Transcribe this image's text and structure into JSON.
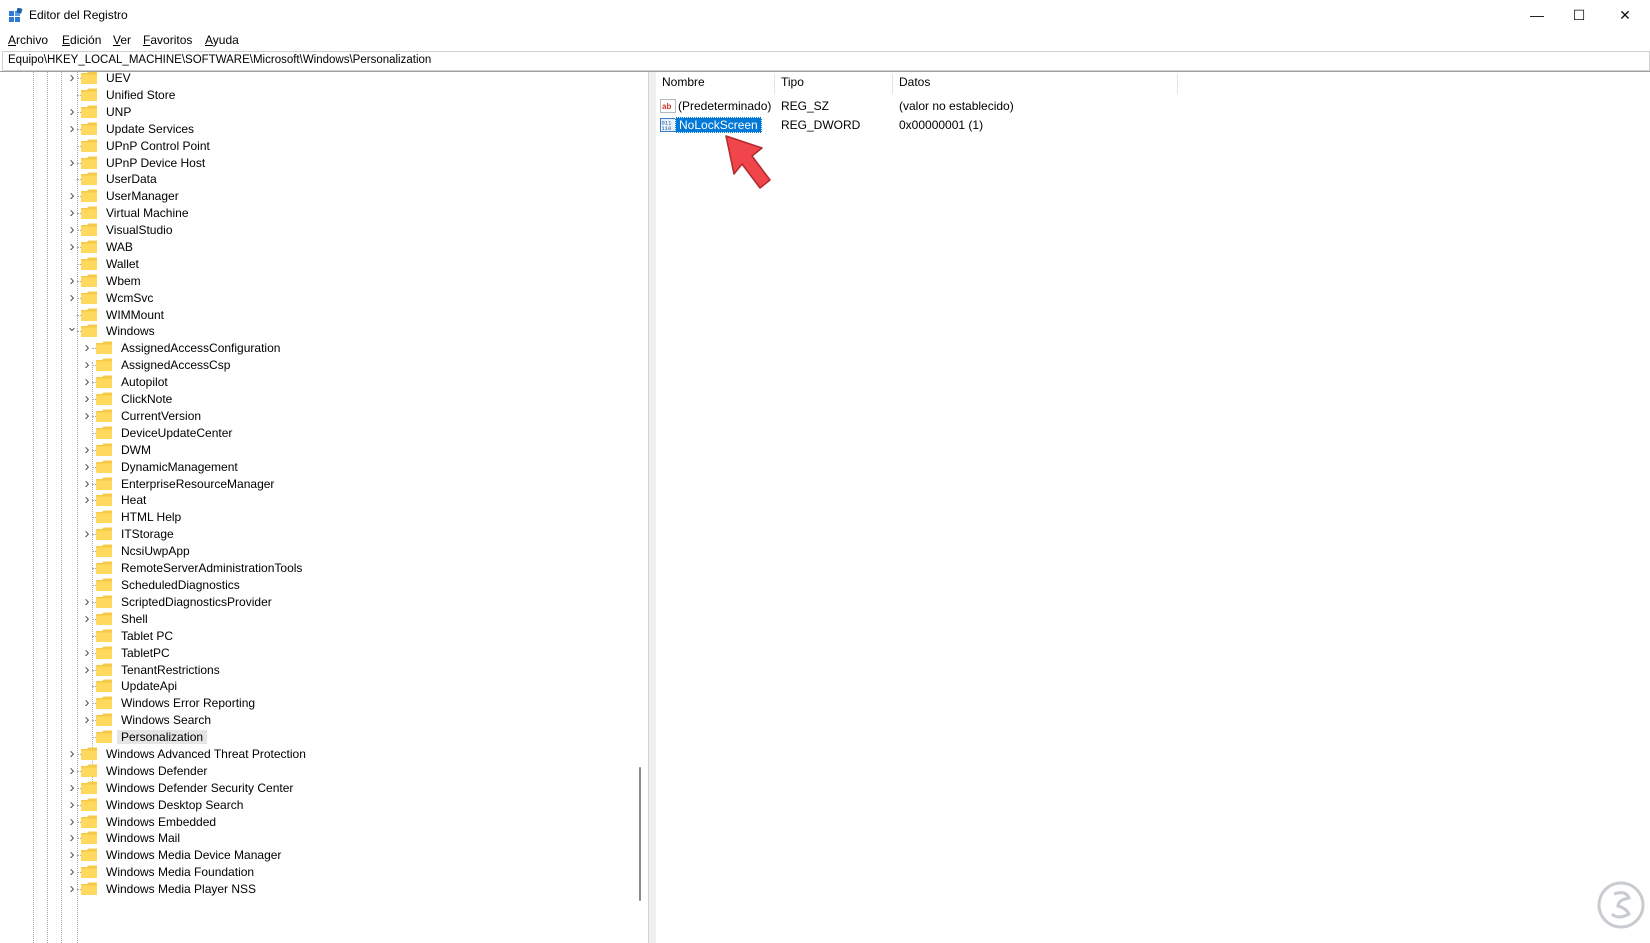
{
  "window": {
    "title": "Editor del Registro",
    "controls": {
      "minimize": "—",
      "maximize": "☐",
      "close": "✕"
    }
  },
  "menu": [
    "Archivo",
    "Edición",
    "Ver",
    "Favoritos",
    "Ayuda"
  ],
  "address": "Equipo\\HKEY_LOCAL_MACHINE\\SOFTWARE\\Microsoft\\Windows\\Personalization",
  "tree": {
    "selected": "Personalization",
    "nodes": [
      {
        "label": "UEV",
        "level": 1,
        "expand": "collapsed"
      },
      {
        "label": "Unified Store",
        "level": 1,
        "expand": "none"
      },
      {
        "label": "UNP",
        "level": 1,
        "expand": "collapsed"
      },
      {
        "label": "Update Services",
        "level": 1,
        "expand": "collapsed"
      },
      {
        "label": "UPnP Control Point",
        "level": 1,
        "expand": "none"
      },
      {
        "label": "UPnP Device Host",
        "level": 1,
        "expand": "collapsed"
      },
      {
        "label": "UserData",
        "level": 1,
        "expand": "none"
      },
      {
        "label": "UserManager",
        "level": 1,
        "expand": "collapsed"
      },
      {
        "label": "Virtual Machine",
        "level": 1,
        "expand": "collapsed"
      },
      {
        "label": "VisualStudio",
        "level": 1,
        "expand": "collapsed"
      },
      {
        "label": "WAB",
        "level": 1,
        "expand": "collapsed"
      },
      {
        "label": "Wallet",
        "level": 1,
        "expand": "none"
      },
      {
        "label": "Wbem",
        "level": 1,
        "expand": "collapsed"
      },
      {
        "label": "WcmSvc",
        "level": 1,
        "expand": "collapsed"
      },
      {
        "label": "WIMMount",
        "level": 1,
        "expand": "none"
      },
      {
        "label": "Windows",
        "level": 1,
        "expand": "expanded"
      },
      {
        "label": "AssignedAccessConfiguration",
        "level": 2,
        "expand": "collapsed"
      },
      {
        "label": "AssignedAccessCsp",
        "level": 2,
        "expand": "collapsed"
      },
      {
        "label": "Autopilot",
        "level": 2,
        "expand": "collapsed"
      },
      {
        "label": "ClickNote",
        "level": 2,
        "expand": "collapsed"
      },
      {
        "label": "CurrentVersion",
        "level": 2,
        "expand": "collapsed"
      },
      {
        "label": "DeviceUpdateCenter",
        "level": 2,
        "expand": "none"
      },
      {
        "label": "DWM",
        "level": 2,
        "expand": "collapsed"
      },
      {
        "label": "DynamicManagement",
        "level": 2,
        "expand": "collapsed"
      },
      {
        "label": "EnterpriseResourceManager",
        "level": 2,
        "expand": "collapsed"
      },
      {
        "label": "Heat",
        "level": 2,
        "expand": "collapsed"
      },
      {
        "label": "HTML Help",
        "level": 2,
        "expand": "none"
      },
      {
        "label": "ITStorage",
        "level": 2,
        "expand": "collapsed"
      },
      {
        "label": "NcsiUwpApp",
        "level": 2,
        "expand": "none"
      },
      {
        "label": "RemoteServerAdministrationTools",
        "level": 2,
        "expand": "none"
      },
      {
        "label": "ScheduledDiagnostics",
        "level": 2,
        "expand": "none"
      },
      {
        "label": "ScriptedDiagnosticsProvider",
        "level": 2,
        "expand": "collapsed"
      },
      {
        "label": "Shell",
        "level": 2,
        "expand": "collapsed"
      },
      {
        "label": "Tablet PC",
        "level": 2,
        "expand": "none"
      },
      {
        "label": "TabletPC",
        "level": 2,
        "expand": "collapsed"
      },
      {
        "label": "TenantRestrictions",
        "level": 2,
        "expand": "collapsed"
      },
      {
        "label": "UpdateApi",
        "level": 2,
        "expand": "none"
      },
      {
        "label": "Windows Error Reporting",
        "level": 2,
        "expand": "collapsed"
      },
      {
        "label": "Windows Search",
        "level": 2,
        "expand": "collapsed"
      },
      {
        "label": "Personalization",
        "level": 2,
        "expand": "none"
      },
      {
        "label": "Windows Advanced Threat Protection",
        "level": 1,
        "expand": "collapsed"
      },
      {
        "label": "Windows Defender",
        "level": 1,
        "expand": "collapsed"
      },
      {
        "label": "Windows Defender Security Center",
        "level": 1,
        "expand": "collapsed"
      },
      {
        "label": "Windows Desktop Search",
        "level": 1,
        "expand": "collapsed"
      },
      {
        "label": "Windows Embedded",
        "level": 1,
        "expand": "collapsed"
      },
      {
        "label": "Windows Mail",
        "level": 1,
        "expand": "collapsed"
      },
      {
        "label": "Windows Media Device Manager",
        "level": 1,
        "expand": "collapsed"
      },
      {
        "label": "Windows Media Foundation",
        "level": 1,
        "expand": "collapsed"
      },
      {
        "label": "Windows Media Player NSS",
        "level": 1,
        "expand": "collapsed"
      }
    ]
  },
  "values": {
    "headers": {
      "name": "Nombre",
      "type": "Tipo",
      "data": "Datos"
    },
    "rows": [
      {
        "name": "(Predeterminado)",
        "type": "REG_SZ",
        "data": "(valor no establecido)",
        "icon": "string-value-icon",
        "selected": false
      },
      {
        "name": "NoLockScreen",
        "type": "REG_DWORD",
        "data": "0x00000001 (1)",
        "icon": "binary-value-icon",
        "selected": true
      }
    ]
  },
  "colors": {
    "folder": "#f5c542",
    "selection": "#0078d7",
    "annotation_arrow": "#f0464b"
  }
}
